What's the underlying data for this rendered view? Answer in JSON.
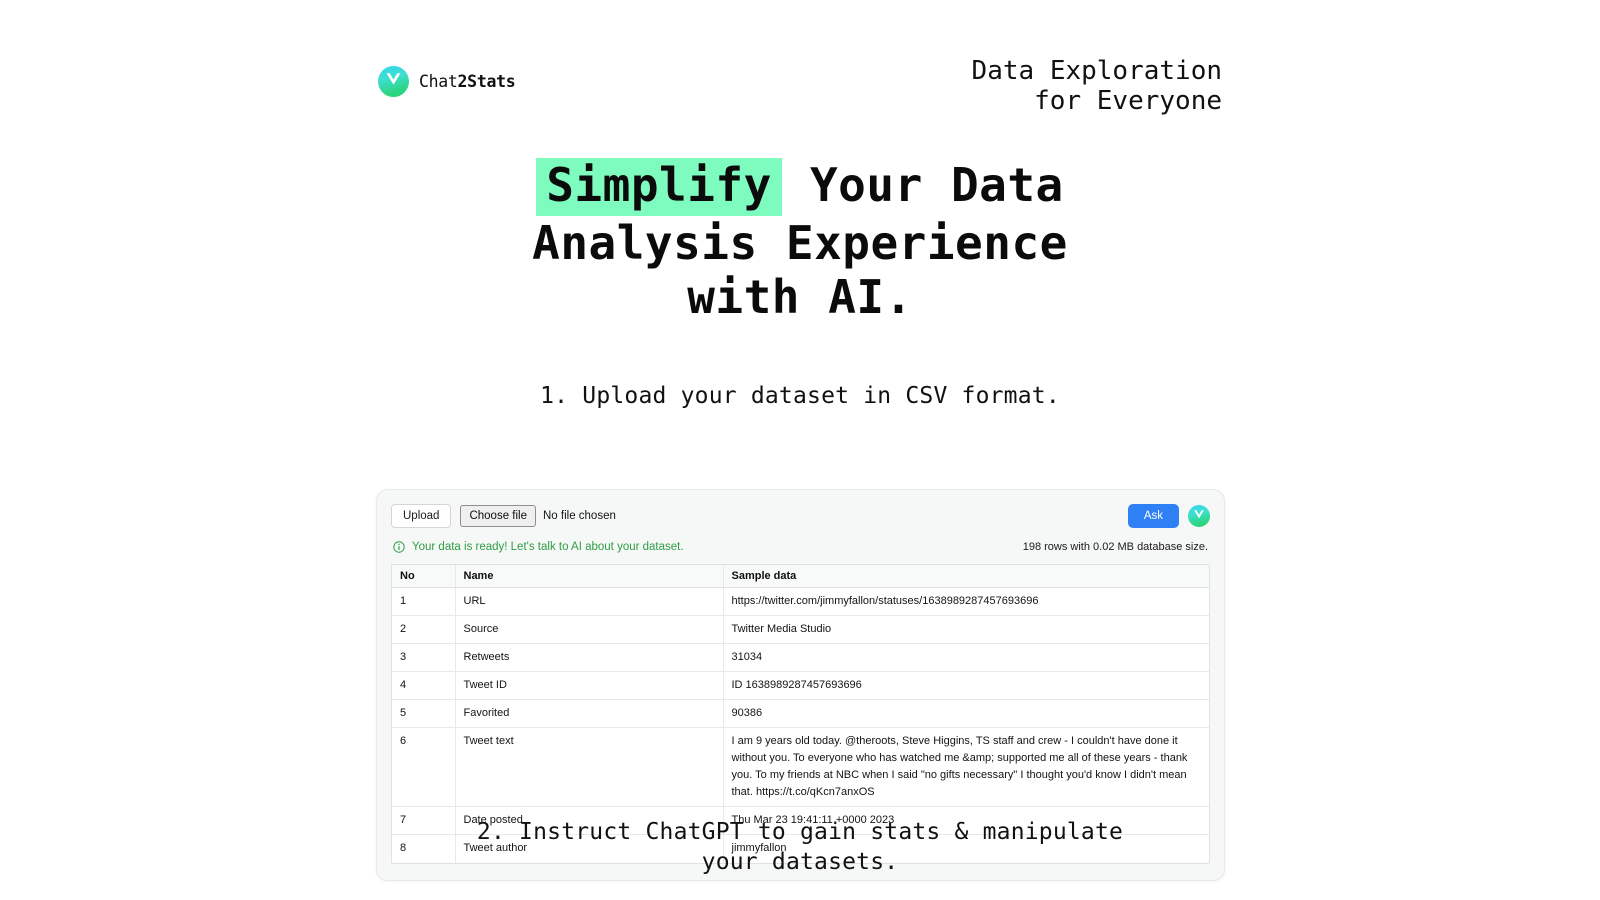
{
  "brand": {
    "name_light": "Chat",
    "name_bold": "2Stats",
    "logo_icon": "chat2stats-logo-icon"
  },
  "header": {
    "tagline": "Data Exploration\nfor Everyone"
  },
  "hero": {
    "highlight_word": "Simplify",
    "rest_line1": " Your Data",
    "line2": "Analysis Experience",
    "line3": "with AI.",
    "highlight_color": "#7efcc0"
  },
  "steps": {
    "step1": "1. Upload your dataset in CSV format.",
    "step2": "2. Instruct ChatGPT to gain stats & manipulate\nyour datasets."
  },
  "app": {
    "toolbar": {
      "upload_label": "Upload",
      "choose_file_label": "Choose file",
      "no_file_label": "No file chosen",
      "ask_label": "Ask",
      "ask_color": "#2f80f5",
      "avatar_icon": "user-avatar-icon"
    },
    "status": {
      "icon": "info-circle-icon",
      "text": "Your data is ready! Let's talk to AI about your dataset.",
      "color": "#2f9e44",
      "db_stats": "198 rows with 0.02 MB database size."
    },
    "table": {
      "columns": [
        "No",
        "Name",
        "Sample data"
      ],
      "rows": [
        {
          "no": "1",
          "name": "URL",
          "sample": "https://twitter.com/jimmyfallon/statuses/1638989287457693696"
        },
        {
          "no": "2",
          "name": "Source",
          "sample": "Twitter Media Studio"
        },
        {
          "no": "3",
          "name": "Retweets",
          "sample": "31034"
        },
        {
          "no": "4",
          "name": "Tweet ID",
          "sample": "ID 1638989287457693696"
        },
        {
          "no": "5",
          "name": "Favorited",
          "sample": "90386"
        },
        {
          "no": "6",
          "name": "Tweet text",
          "sample": "I am 9 years old today. @theroots, Steve Higgins, TS staff and crew - I couldn't have done it without you. To everyone who has watched me &amp; supported me all of these years - thank you. To my friends at NBC when I said \"no gifts necessary\" I thought you'd know I didn't mean that. https://t.co/qKcn7anxOS"
        },
        {
          "no": "7",
          "name": "Date posted",
          "sample": "Thu Mar 23 19:41:11 +0000 2023"
        },
        {
          "no": "8",
          "name": "Tweet author",
          "sample": "jimmyfallon"
        }
      ]
    }
  }
}
